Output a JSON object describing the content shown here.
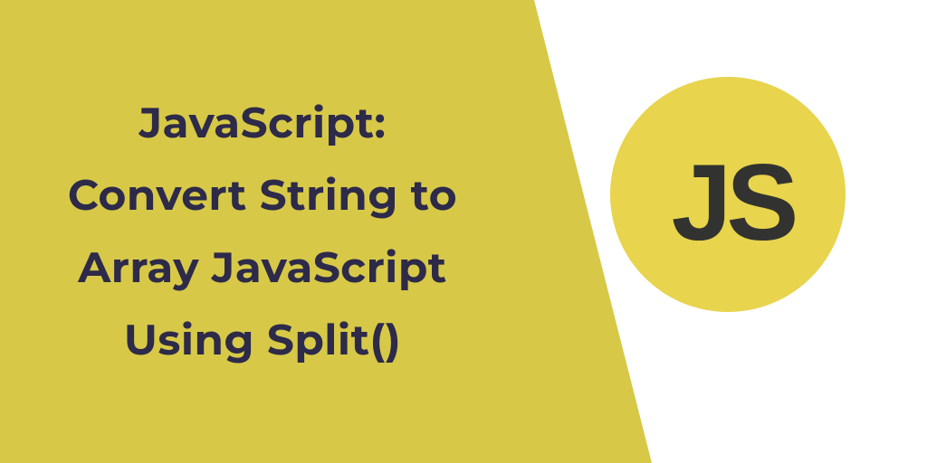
{
  "heading_line1": "JavaScript:",
  "heading_line2": "Convert String to",
  "heading_line3": "Array JavaScript",
  "heading_line4": "Using Split()",
  "logo_text": "JS",
  "colors": {
    "yellow": "#d7c947",
    "logo_yellow": "#e8d44d",
    "dark_text": "#2d2a4a",
    "logo_dark": "#323330"
  }
}
